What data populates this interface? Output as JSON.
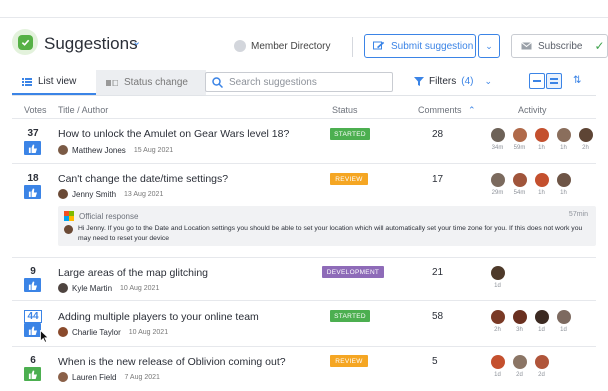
{
  "header": {
    "title": "Suggestions",
    "member_directory": "Member Directory",
    "submit_label": "Submit suggestion",
    "subscribe_label": "Subscribe"
  },
  "toolbar": {
    "tab_list": "List view",
    "tab_status": "Status change",
    "search_placeholder": "Search suggestions",
    "filters_label": "Filters",
    "filters_count": "(4)"
  },
  "columns": {
    "votes": "Votes",
    "title": "Title / Author",
    "status": "Status",
    "comments": "Comments",
    "activity": "Activity"
  },
  "rows": [
    {
      "votes": "37",
      "title": "How to unlock the Amulet on Gear Wars level 18?",
      "author": "Matthew Jones",
      "date": "15 Aug 2021",
      "status": "STARTED",
      "comments": "28",
      "activity": [
        "34m",
        "59m",
        "1h",
        "1h",
        "2h"
      ]
    },
    {
      "votes": "18",
      "title": "Can't change the date/time settings?",
      "author": "Jenny Smith",
      "date": "13 Aug 2021",
      "status": "REVIEW",
      "comments": "17",
      "activity": [
        "29m",
        "54m",
        "1h",
        "1h"
      ]
    },
    {
      "votes": "9",
      "title": "Large areas of the map glitching",
      "author": "Kyle Martin",
      "date": "10 Aug 2021",
      "status": "DEVELOPMENT",
      "comments": "21",
      "activity": [
        "1d"
      ]
    },
    {
      "votes": "44",
      "title": "Adding multiple players to your online team",
      "author": "Charlie Taylor",
      "date": "10 Aug 2021",
      "status": "STARTED",
      "comments": "58",
      "activity": [
        "2h",
        "3h",
        "1d",
        "1d"
      ]
    },
    {
      "votes": "6",
      "title": "When is the new release of Oblivion coming out?",
      "author": "Lauren Field",
      "date": "7 Aug 2021",
      "status": "REVIEW",
      "comments": "5",
      "activity": [
        "1d",
        "2d",
        "2d"
      ]
    }
  ],
  "official_response": {
    "label": "Official response",
    "time": "57min",
    "text": "Hi Jenny. If you go to the Date and Location settings you should be able to set your location which will automatically set your time zone for you. If this does not work you may need to reset your device"
  },
  "colors": {
    "accent": "#3b84e6",
    "started": "#4caf50",
    "review": "#f5a623",
    "development": "#8e6bb8"
  }
}
